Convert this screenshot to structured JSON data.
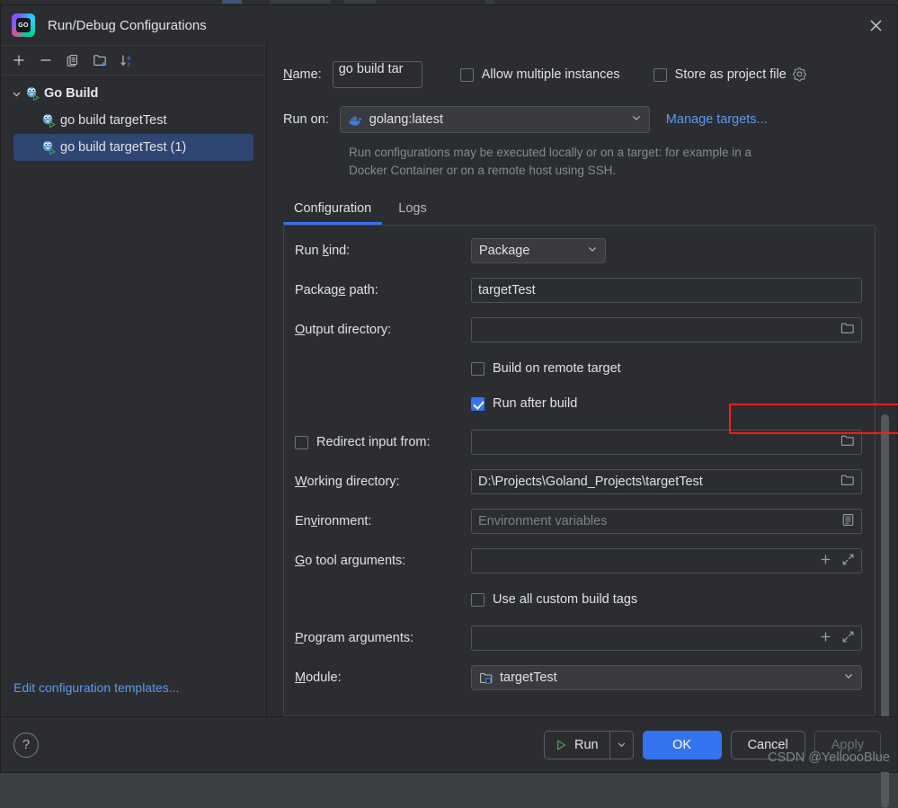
{
  "window": {
    "title": "Run/Debug Configurations",
    "logo_text": "GO",
    "logo_icon": "goland-logo-icon",
    "close_icon": "close-icon"
  },
  "sidebar": {
    "toolbar": [
      {
        "name": "add-configuration-button",
        "icon": "plus-icon",
        "label": "+"
      },
      {
        "name": "remove-configuration-button",
        "icon": "minus-icon",
        "label": "−"
      },
      {
        "name": "copy-configuration-button",
        "icon": "copy-icon",
        "label": "copy"
      },
      {
        "name": "new-folder-button",
        "icon": "folder-plus-icon",
        "label": "new folder"
      },
      {
        "name": "sort-configurations-button",
        "icon": "sort-az-icon",
        "label": "sort a-z"
      }
    ],
    "tree": [
      {
        "label": "Go Build",
        "level": "group",
        "expanded": true,
        "selected": false,
        "icon": "go-build-icon"
      },
      {
        "label": "go build targetTest",
        "level": "child",
        "selected": false,
        "icon": "go-build-icon"
      },
      {
        "label": "go build targetTest (1)",
        "level": "child",
        "selected": true,
        "icon": "go-build-icon"
      }
    ],
    "edit_templates_link": "Edit configuration templates..."
  },
  "form": {
    "name_label": "Name:",
    "name_label_mnemonic": "N",
    "name_value": "go build tar",
    "name_placeholder": "",
    "allow_multiple_instances": {
      "label": "Allow multiple instances",
      "checked": false
    },
    "store_as_project_file": {
      "label": "Store as project file",
      "checked": false,
      "gear_icon": "gear-icon"
    },
    "run_on_label": "Run on:",
    "run_on_value": "golang:latest",
    "run_on_icon": "docker-icon",
    "manage_targets_link": "Manage targets...",
    "hint_text": "Run configurations may be executed locally or on a target: for example in a Docker Container or on a remote host using SSH."
  },
  "tabs": [
    {
      "label": "Configuration",
      "active": true
    },
    {
      "label": "Logs",
      "active": false
    }
  ],
  "config": {
    "run_kind": {
      "label": "Run kind:",
      "mnemonic": "k",
      "value": "Package"
    },
    "package_path": {
      "label": "Package path:",
      "mnemonic": "e",
      "value": "targetTest"
    },
    "output_directory": {
      "label": "Output directory:",
      "mnemonic": "O",
      "value": "",
      "placeholder": "",
      "browse_icon": "folder-icon"
    },
    "build_on_remote_target": {
      "label": "Build on remote target",
      "checked": false,
      "highlight_color": "#ff1a1a"
    },
    "run_after_build": {
      "label": "Run after build",
      "checked": true
    },
    "redirect_input_from": {
      "label": "Redirect input from:",
      "checked": false,
      "value": "",
      "browse_icon": "folder-icon"
    },
    "working_directory": {
      "label": "Working directory:",
      "mnemonic": "W",
      "value": "D:\\Projects\\Goland_Projects\\targetTest",
      "browse_icon": "folder-icon"
    },
    "environment": {
      "label": "Environment:",
      "mnemonic": "v",
      "value": "",
      "placeholder": "Environment variables",
      "edit_icon": "list-edit-icon"
    },
    "go_tool_arguments": {
      "label": "Go tool arguments:",
      "mnemonic": "G",
      "value": "",
      "add_icon": "plus-icon",
      "expand_icon": "expand-icon"
    },
    "use_all_custom_build_tags": {
      "label": "Use all custom build tags",
      "checked": false
    },
    "program_arguments": {
      "label": "Program arguments:",
      "mnemonic": "P",
      "value": "",
      "add_icon": "plus-icon",
      "expand_icon": "expand-icon"
    },
    "module": {
      "label": "Module:",
      "mnemonic": "M",
      "value": "targetTest",
      "icon": "module-folder-icon"
    }
  },
  "footer": {
    "help_label": "?",
    "help_icon": "help-icon",
    "run_label": "Run",
    "run_icon": "play-icon",
    "run_dropdown_icon": "chevron-down-icon",
    "ok_label": "OK",
    "cancel_label": "Cancel",
    "apply_label": "Apply",
    "apply_disabled": true
  },
  "watermark": "CSDN @YelloooBlue",
  "colors": {
    "accent": "#3574f0",
    "link": "#5a9bf0",
    "highlight_red": "#ff1a1a",
    "panel_bg": "#2b2d30",
    "selection_bg": "#2f4673",
    "run_green": "#499c54"
  }
}
